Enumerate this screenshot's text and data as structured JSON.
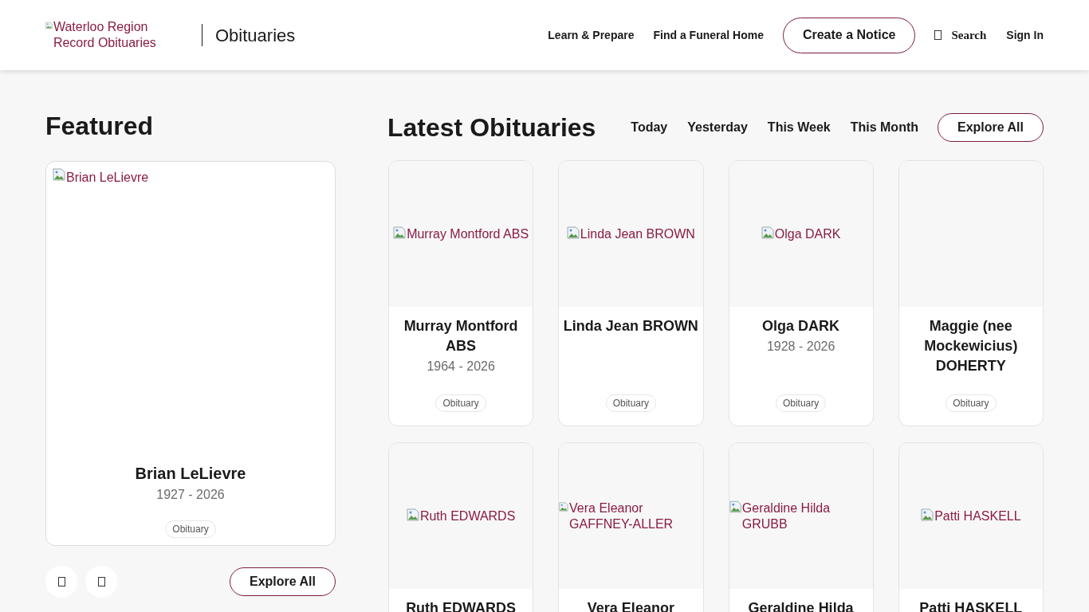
{
  "header": {
    "logo_alt": "Waterloo Region Record Obituaries",
    "section": "Obituaries",
    "nav": [
      "Learn & Prepare",
      "Find a Funeral Home"
    ],
    "cta": "Create a Notice",
    "search": "Search",
    "sign_in": "Sign In"
  },
  "featured": {
    "title": "Featured",
    "card": {
      "image_alt": "Brian LeLievre",
      "name": "Brian LeLievre",
      "years": "1927 - 2026",
      "tag": "Obituary"
    },
    "explore": "Explore All"
  },
  "latest": {
    "title": "Latest Obituaries",
    "filters": [
      "Today",
      "Yesterday",
      "This Week",
      "This Month"
    ],
    "explore": "Explore All",
    "cards": [
      {
        "image_alt": "Murray Montford ABS",
        "name": "Murray Montford ABS",
        "years": "1964 - 2026",
        "tag": "Obituary"
      },
      {
        "image_alt": "Linda Jean BROWN",
        "name": "Linda Jean BROWN",
        "tag": "Obituary"
      },
      {
        "image_alt": "Olga DARK",
        "name": "Olga DARK",
        "years": "1928 - 2026",
        "tag": "Obituary"
      },
      {
        "name": "Maggie (nee Mockewicius) DOHERTY",
        "tag": "Obituary"
      },
      {
        "image_alt": "Ruth EDWARDS",
        "name": "Ruth EDWARDS"
      },
      {
        "image_alt": "Vera Eleanor GAFFNEY-ALLER",
        "name": "Vera Eleanor"
      },
      {
        "image_alt": "Geraldine Hilda GRUBB",
        "name": "Geraldine Hilda"
      },
      {
        "image_alt": "Patti HASKELL",
        "name": "Patti HASKELL"
      }
    ]
  }
}
